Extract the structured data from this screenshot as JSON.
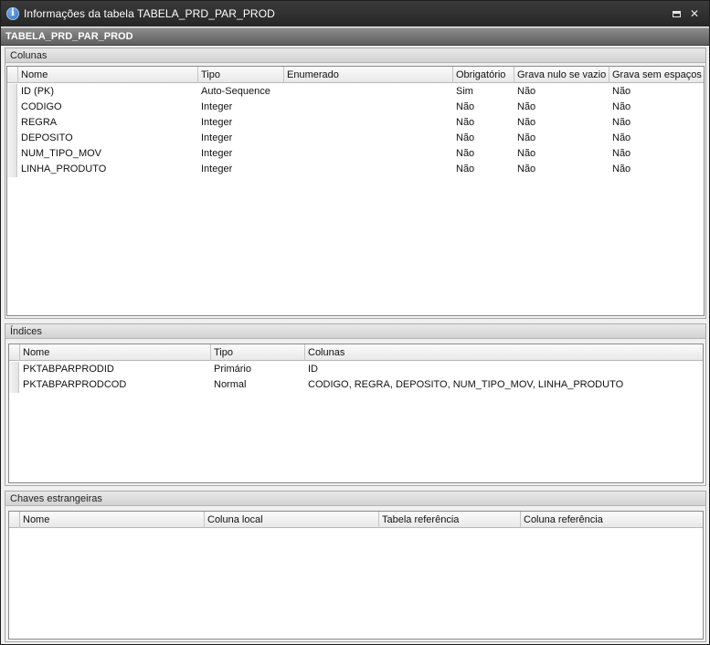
{
  "window": {
    "title": "Informações da tabela TABELA_PRD_PAR_PROD",
    "table_name": "TABELA_PRD_PAR_PROD",
    "icon": "info-icon"
  },
  "colunas": {
    "header": "Colunas",
    "columns": [
      "Nome",
      "Tipo",
      "Enumerado",
      "Obrigatório",
      "Grava nulo se vazio",
      "Grava sem espaços"
    ],
    "rows": [
      [
        "ID (PK)",
        "Auto-Sequence",
        "",
        "Sim",
        "Não",
        "Não"
      ],
      [
        "CODIGO",
        "Integer",
        "",
        "Não",
        "Não",
        "Não"
      ],
      [
        "REGRA",
        "Integer",
        "",
        "Não",
        "Não",
        "Não"
      ],
      [
        "DEPOSITO",
        "Integer",
        "",
        "Não",
        "Não",
        "Não"
      ],
      [
        "NUM_TIPO_MOV",
        "Integer",
        "",
        "Não",
        "Não",
        "Não"
      ],
      [
        "LINHA_PRODUTO",
        "Integer",
        "",
        "Não",
        "Não",
        "Não"
      ]
    ]
  },
  "indices": {
    "header": "Índices",
    "columns": [
      "Nome",
      "Tipo",
      "Colunas"
    ],
    "rows": [
      [
        "PKTABPARPRODID",
        "Primário",
        "ID"
      ],
      [
        "PKTABPARPRODCOD",
        "Normal",
        "CODIGO, REGRA, DEPOSITO, NUM_TIPO_MOV, LINHA_PRODUTO"
      ]
    ]
  },
  "chaves": {
    "header": "Chaves estrangeiras",
    "columns": [
      "Nome",
      "Coluna local",
      "Tabela referência",
      "Coluna referência"
    ],
    "rows": []
  }
}
